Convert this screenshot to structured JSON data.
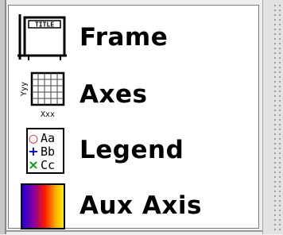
{
  "items": [
    {
      "label": "Frame",
      "icon": "frame-icon",
      "icon_text": "TITLE"
    },
    {
      "label": "Axes",
      "icon": "axes-icon",
      "icon_ylabel": "Yyy",
      "icon_xlabel": "Xxx"
    },
    {
      "label": "Legend",
      "icon": "legend-icon",
      "icon_rows": [
        {
          "marker": "○",
          "text": "Aa",
          "color": "#e00000"
        },
        {
          "marker": "+",
          "text": "Bb",
          "color": "#0000e0"
        },
        {
          "marker": "×",
          "text": "Cc",
          "color": "#00a000"
        }
      ]
    },
    {
      "label": "Aux Axis",
      "icon": "aux-axis-icon",
      "gradient_colors": [
        "#1a00d8",
        "#8a00a0",
        "#ff1a00",
        "#ffb000",
        "#fff200"
      ]
    }
  ],
  "colors": {
    "panel_background": "#ffffff",
    "window_background": "#eeeeee",
    "text": "#000000"
  }
}
